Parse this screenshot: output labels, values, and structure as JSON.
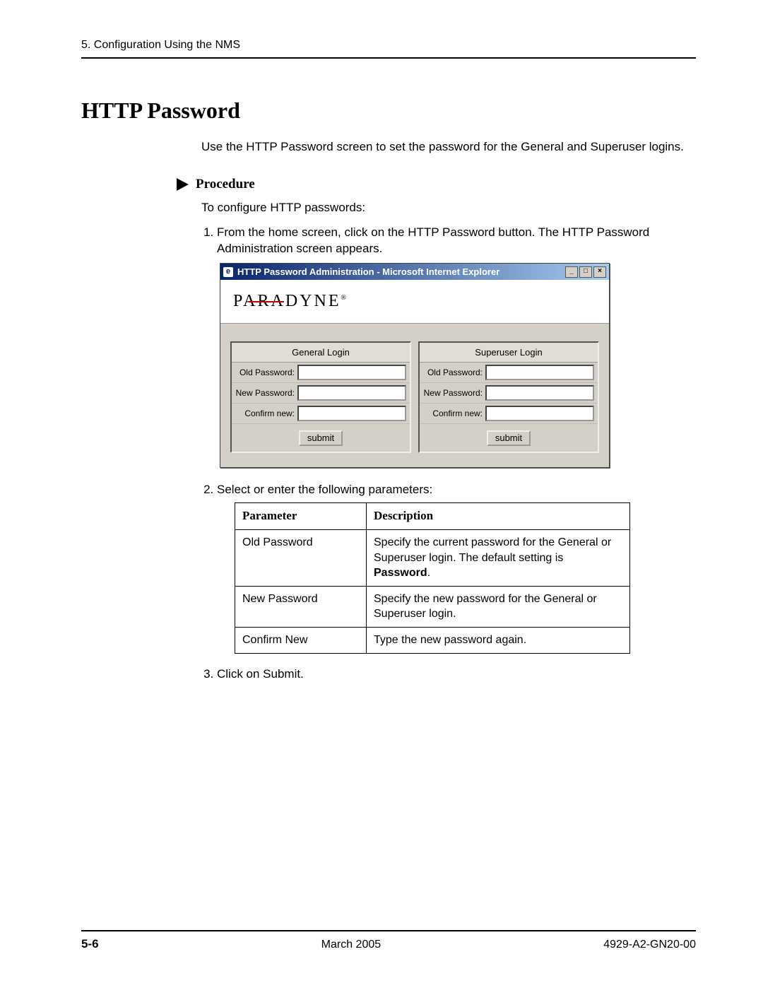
{
  "header": {
    "chapter": "5. Configuration Using the NMS"
  },
  "title": "HTTP Password",
  "intro": "Use the HTTP Password screen to set the password for the General and Superuser logins.",
  "procedure_label": "Procedure",
  "step_intro": "To configure HTTP passwords:",
  "steps": {
    "s1": "From the home screen, click on the HTTP Password button. The HTTP Password Administration screen appears.",
    "s2": "Select or enter the following parameters:",
    "s3": "Click on Submit."
  },
  "ie": {
    "title": "HTTP Password Administration - Microsoft Internet Explorer",
    "logo": "PARADYNE",
    "logo_reg": "®",
    "left": {
      "header": "General Login",
      "old": "Old Password:",
      "new": "New Password:",
      "confirm": "Confirm new:",
      "submit": "submit"
    },
    "right": {
      "header": "Superuser Login",
      "old": "Old Password:",
      "new": "New Password:",
      "confirm": "Confirm new:",
      "submit": "submit"
    },
    "win_min": "_",
    "win_max": "□",
    "win_close": "×"
  },
  "table": {
    "h_param": "Parameter",
    "h_desc": "Description",
    "rows": {
      "r0_p": "Old Password",
      "r0_d_a": "Specify the current password for the General or Superuser login. The default setting is ",
      "r0_d_b": "Password",
      "r0_d_c": ".",
      "r1_p": "New Password",
      "r1_d": "Specify the new password for the General or Superuser login.",
      "r2_p": "Confirm New",
      "r2_d": "Type the new password again."
    }
  },
  "footer": {
    "page": "5-6",
    "center": "March 2005",
    "doc": "4929-A2-GN20-00"
  }
}
